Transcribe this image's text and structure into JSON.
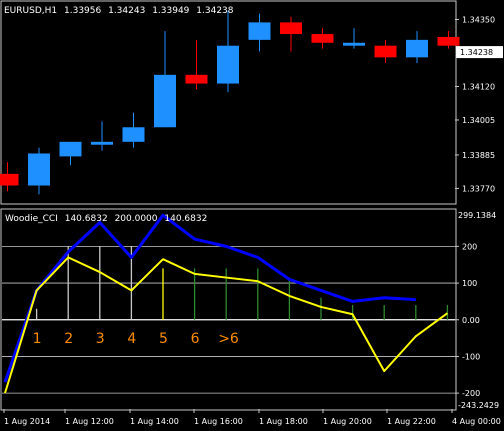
{
  "main_panel": {
    "symbol_label": "EURUSD,H1",
    "ohlc_values": [
      "1.33956",
      "1.34243",
      "1.33949",
      "1.34238"
    ],
    "price_ticks": [
      "1.34350",
      "1.34238",
      "1.34120",
      "1.34005",
      "1.33885",
      "1.33770"
    ],
    "current_price_tag": "1.34238",
    "up_color": "#1e90ff",
    "down_color": "#ff0000"
  },
  "indicator_panel": {
    "label": "Woodie_CCI",
    "label_values": [
      "140.6832",
      "200.0000",
      "140.6832"
    ],
    "max_value_label": "299.1384",
    "min_value_label": "-243.2429",
    "level_ticks": [
      "200",
      "100",
      "0.00",
      "-100",
      "-200"
    ],
    "count_labels": [
      "1",
      "2",
      "3",
      "4",
      "5",
      "6",
      ">6"
    ],
    "count_label_color": "#ff8c00",
    "cci_color": "#0000ff",
    "tcci_color": "#ffff00"
  },
  "time_axis": {
    "labels": [
      "1 Aug 2014",
      "1 Aug 12:00",
      "1 Aug 14:00",
      "1 Aug 16:00",
      "1 Aug 18:00",
      "1 Aug 20:00",
      "1 Aug 22:00",
      "4 Aug 00:00"
    ]
  },
  "chart_data": [
    {
      "type": "candlestick",
      "title": "EURUSD,H1",
      "ylim": [
        1.3372,
        1.3441
      ],
      "candles": [
        {
          "open": 1.3382,
          "high": 1.3386,
          "low": 1.3376,
          "close": 1.3378
        },
        {
          "open": 1.3378,
          "high": 1.3391,
          "low": 1.3375,
          "close": 1.3389
        },
        {
          "open": 1.3388,
          "high": 1.3392,
          "low": 1.3385,
          "close": 1.3393
        },
        {
          "open": 1.3392,
          "high": 1.34,
          "low": 1.339,
          "close": 1.3393
        },
        {
          "open": 1.3393,
          "high": 1.3403,
          "low": 1.3391,
          "close": 1.3398
        },
        {
          "open": 1.3398,
          "high": 1.3431,
          "low": 1.3398,
          "close": 1.3416
        },
        {
          "open": 1.3416,
          "high": 1.3428,
          "low": 1.3411,
          "close": 1.3413
        },
        {
          "open": 1.3413,
          "high": 1.3438,
          "low": 1.341,
          "close": 1.3426
        },
        {
          "open": 1.3428,
          "high": 1.3437,
          "low": 1.3424,
          "close": 1.3434
        },
        {
          "open": 1.3434,
          "high": 1.3436,
          "low": 1.3424,
          "close": 1.343
        },
        {
          "open": 1.343,
          "high": 1.3432,
          "low": 1.3425,
          "close": 1.3427
        },
        {
          "open": 1.3426,
          "high": 1.3432,
          "low": 1.3425,
          "close": 1.3427
        },
        {
          "open": 1.3426,
          "high": 1.3428,
          "low": 1.342,
          "close": 1.3422
        },
        {
          "open": 1.3422,
          "high": 1.3431,
          "low": 1.342,
          "close": 1.3428
        },
        {
          "open": 1.3429,
          "high": 1.3431,
          "low": 1.3425,
          "close": 1.3426
        }
      ]
    },
    {
      "type": "line",
      "title": "Woodie_CCI",
      "ylim": [
        -243.2429,
        299.1384
      ],
      "levels": [
        200,
        100,
        0,
        -100,
        -200
      ],
      "series": [
        {
          "name": "CCI",
          "values": [
            -170,
            80,
            185,
            265,
            170,
            285,
            220,
            200,
            170,
            110,
            80,
            50,
            60,
            55
          ]
        },
        {
          "name": "TCCI",
          "values": [
            -200,
            80,
            170,
            130,
            80,
            165,
            125,
            115,
            105,
            65,
            35,
            15,
            -140,
            -45,
            18
          ]
        }
      ],
      "histogram": [
        0,
        30,
        200,
        200,
        200,
        140,
        140,
        140,
        140,
        110,
        60,
        40,
        40,
        40,
        40
      ],
      "histogram_colors": [
        "none",
        "gray",
        "gray",
        "gray",
        "gray",
        "yellow",
        "green",
        "green",
        "green",
        "green",
        "green",
        "green",
        "green",
        "green",
        "green"
      ]
    }
  ]
}
